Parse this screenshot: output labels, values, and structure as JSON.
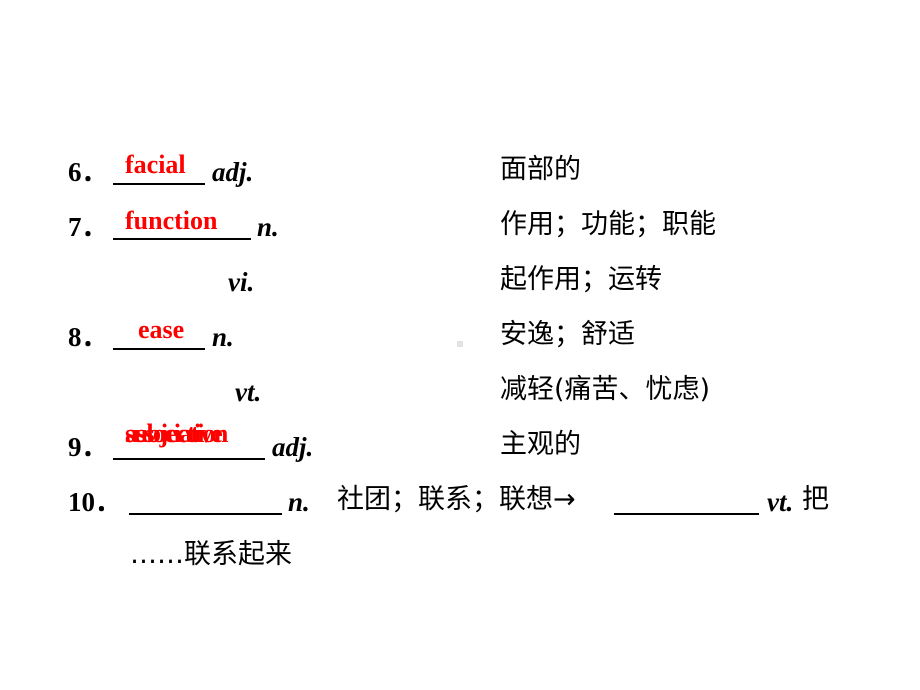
{
  "items": [
    {
      "num": "6．",
      "answer": "facial",
      "pos": "adj.",
      "meaning": "面部的"
    },
    {
      "num": "7．",
      "answer": "function",
      "pos": "n.",
      "meaning": "作用；功能；职能"
    },
    {
      "pos2": "vi.",
      "meaning2": "起作用；运转"
    },
    {
      "num": "8．",
      "answer": "ease",
      "pos": "n.",
      "meaning": "安逸；舒适"
    },
    {
      "pos2": "vt.",
      "meaning2": "减轻(痛苦、忧虑)"
    },
    {
      "num": "9．",
      "answer_a": "subjective",
      "answer_b": "association",
      "pos": "adj.",
      "meaning": "主观的"
    },
    {
      "num": "10．",
      "pos": "n.",
      "meaning": "社团；联系；联想→",
      "pos_b": "vt.",
      "meaning_b": "把",
      "continuation": "……联系起来"
    }
  ]
}
